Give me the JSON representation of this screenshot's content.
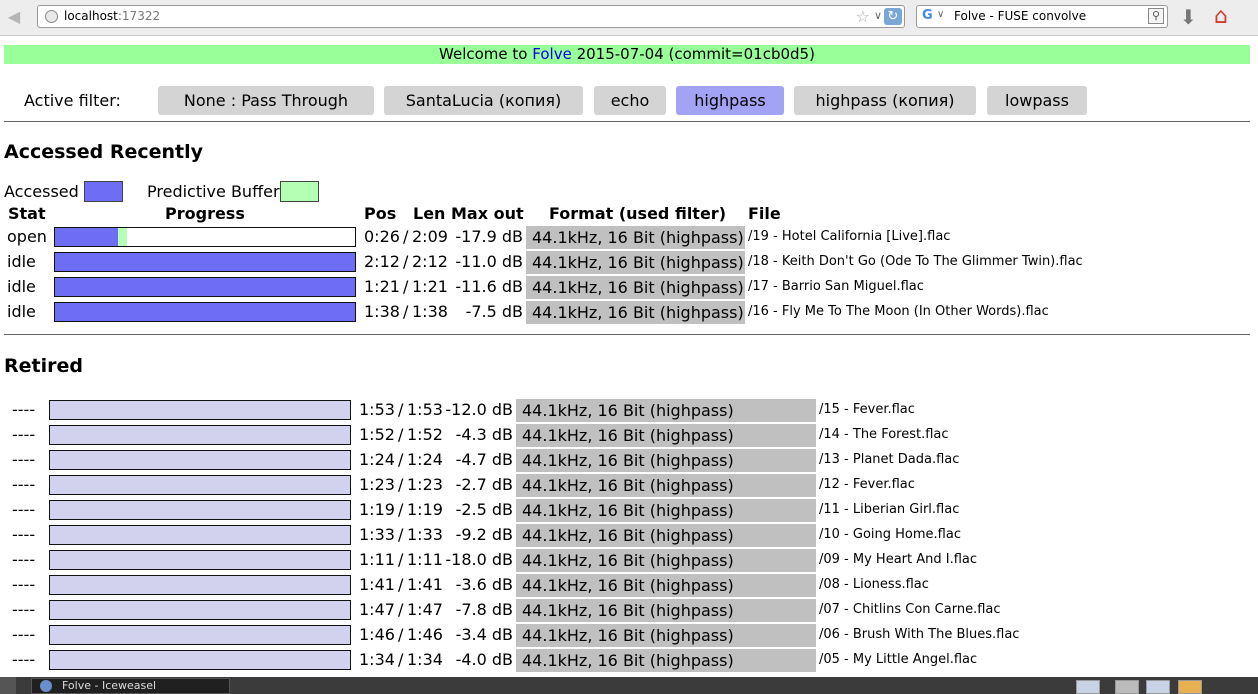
{
  "browser": {
    "url_host": "localhost",
    "url_port": ":17322",
    "search_text": "Folve - FUSE convolve",
    "search_engine_icon": "G"
  },
  "welcome": {
    "prefix": "Welcome to ",
    "link": "Folve",
    "suffix": " 2015-07-04 (commit=01cb0d5)"
  },
  "filters": {
    "label": "Active filter:",
    "items": [
      {
        "label": "None : Pass Through",
        "active": false
      },
      {
        "label": "SantaLucia (копия)",
        "active": false
      },
      {
        "label": "echo",
        "active": false
      },
      {
        "label": "highpass",
        "active": true
      },
      {
        "label": "highpass (копия)",
        "active": false
      },
      {
        "label": "lowpass",
        "active": false
      }
    ]
  },
  "recent": {
    "title": "Accessed Recently",
    "legend_accessed": "Accessed",
    "legend_buffer": "Predictive Buffer",
    "headers": {
      "stat": "Stat",
      "progress": "Progress",
      "pos": "Pos",
      "len": "Len",
      "max_out": "Max out",
      "format": "Format (used filter)",
      "file": "File"
    },
    "rows": [
      {
        "stat": "open",
        "progress": 0.21,
        "buffer": 0.03,
        "pos": "0:26",
        "sep": "/",
        "len": "2:09",
        "max": "-17.9 dB",
        "format": "44.1kHz, 16 Bit (highpass)",
        "file": "/19 - Hotel California [Live].flac"
      },
      {
        "stat": "idle",
        "progress": 1,
        "buffer": 0,
        "pos": "2:12",
        "sep": "/",
        "len": "2:12",
        "max": "-11.0 dB",
        "format": "44.1kHz, 16 Bit (highpass)",
        "file": "/18 - Keith Don't Go (Ode To The Glimmer Twin).flac"
      },
      {
        "stat": "idle",
        "progress": 1,
        "buffer": 0,
        "pos": "1:21",
        "sep": "/",
        "len": "1:21",
        "max": "-11.6 dB",
        "format": "44.1kHz, 16 Bit (highpass)",
        "file": "/17 - Barrio San Miguel.flac"
      },
      {
        "stat": "idle",
        "progress": 1,
        "buffer": 0,
        "pos": "1:38",
        "sep": "/",
        "len": "1:38",
        "max": "-7.5 dB",
        "format": "44.1kHz, 16 Bit (highpass)",
        "file": "/16 - Fly Me To The Moon (In Other Words).flac"
      }
    ]
  },
  "retired": {
    "title": "Retired",
    "rows": [
      {
        "stat": "----",
        "pos": "1:53",
        "sep": "/",
        "len": "1:53",
        "max": "-12.0 dB",
        "format": "44.1kHz, 16 Bit (highpass)",
        "file": "/15 - Fever.flac"
      },
      {
        "stat": "----",
        "pos": "1:52",
        "sep": "/",
        "len": "1:52",
        "max": "-4.3 dB",
        "format": "44.1kHz, 16 Bit (highpass)",
        "file": "/14 - The Forest.flac"
      },
      {
        "stat": "----",
        "pos": "1:24",
        "sep": "/",
        "len": "1:24",
        "max": "-4.7 dB",
        "format": "44.1kHz, 16 Bit (highpass)",
        "file": "/13 - Planet Dada.flac"
      },
      {
        "stat": "----",
        "pos": "1:23",
        "sep": "/",
        "len": "1:23",
        "max": "-2.7 dB",
        "format": "44.1kHz, 16 Bit (highpass)",
        "file": "/12 - Fever.flac"
      },
      {
        "stat": "----",
        "pos": "1:19",
        "sep": "/",
        "len": "1:19",
        "max": "-2.5 dB",
        "format": "44.1kHz, 16 Bit (highpass)",
        "file": "/11 - Liberian Girl.flac"
      },
      {
        "stat": "----",
        "pos": "1:33",
        "sep": "/",
        "len": "1:33",
        "max": "-9.2 dB",
        "format": "44.1kHz, 16 Bit (highpass)",
        "file": "/10 - Going Home.flac"
      },
      {
        "stat": "----",
        "pos": "1:11",
        "sep": "/",
        "len": "1:11",
        "max": "-18.0 dB",
        "format": "44.1kHz, 16 Bit (highpass)",
        "file": "/09 - My Heart And I.flac"
      },
      {
        "stat": "----",
        "pos": "1:41",
        "sep": "/",
        "len": "1:41",
        "max": "-3.6 dB",
        "format": "44.1kHz, 16 Bit (highpass)",
        "file": "/08 - Lioness.flac"
      },
      {
        "stat": "----",
        "pos": "1:47",
        "sep": "/",
        "len": "1:47",
        "max": "-7.8 dB",
        "format": "44.1kHz, 16 Bit (highpass)",
        "file": "/07 - Chitlins Con Carne.flac"
      },
      {
        "stat": "----",
        "pos": "1:46",
        "sep": "/",
        "len": "1:46",
        "max": "-3.4 dB",
        "format": "44.1kHz, 16 Bit (highpass)",
        "file": "/06 - Brush With The Blues.flac"
      },
      {
        "stat": "----",
        "pos": "1:34",
        "sep": "/",
        "len": "1:34",
        "max": "-4.0 dB",
        "format": "44.1kHz, 16 Bit (highpass)",
        "file": "/05 - My Little Angel.flac"
      }
    ]
  },
  "taskbar": {
    "window_label": "Folve - Iceweasel"
  },
  "colors": {
    "welcome_bg": "#99ff99",
    "accessed": "#6e6ef5",
    "buffer": "#b5ffb5",
    "active_filter": "#a3a3f5",
    "retired_bar": "#d2d2ee"
  },
  "icons": [
    "back-arrow-icon",
    "globe-icon",
    "star-icon",
    "reload-icon",
    "google-icon",
    "magnifier-icon",
    "download-icon",
    "home-icon"
  ]
}
